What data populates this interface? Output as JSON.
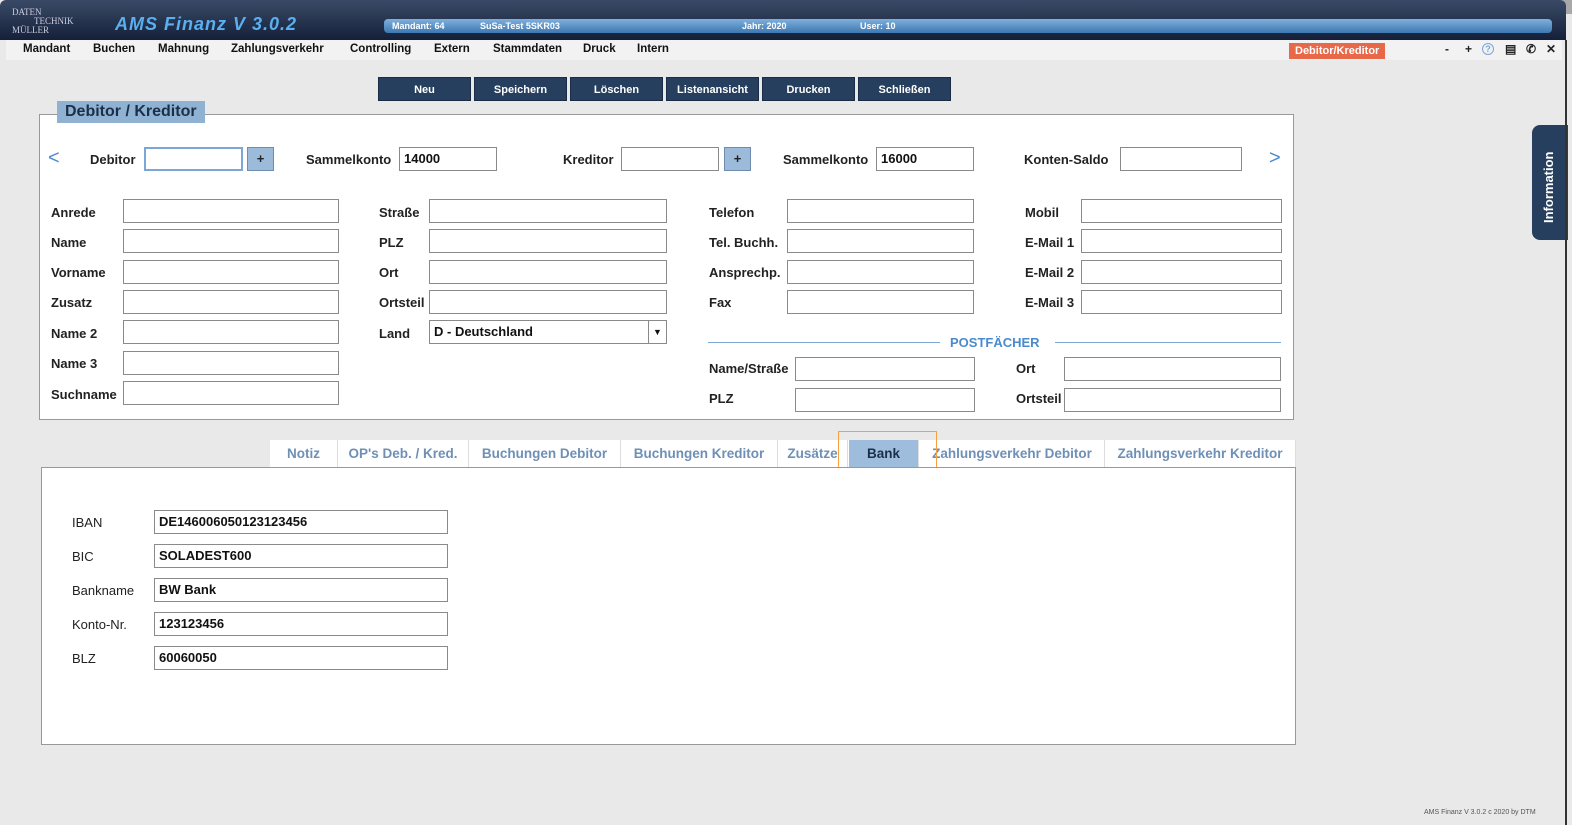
{
  "app": {
    "logo": [
      "DATEN",
      "TECHNIK",
      "MÜLLER"
    ],
    "title": "AMS Finanz V 3.0.2",
    "mandant": "Mandant: 64",
    "mandant_name": "SuSa-Test 5SKR03",
    "jahr": "Jahr: 2020",
    "user": "User: 10",
    "footer": "AMS Finanz V 3.0.2 c  2020 by DTM"
  },
  "menu": [
    "Mandant",
    "Buchen",
    "Mahnung",
    "Zahlungsverkehr",
    "Controlling",
    "Extern",
    "Stammdaten",
    "Druck",
    "Intern"
  ],
  "context_badge": "Debitor/Kreditor",
  "title_icons": {
    "minimize": "-",
    "maximize": "+",
    "help": "?",
    "notes": "▤",
    "phone": "✆",
    "close": "✕"
  },
  "toolbar": [
    "Neu",
    "Speichern",
    "Löschen",
    "Listenansicht",
    "Drucken",
    "Schließen"
  ],
  "form": {
    "title": "Debitor / Kreditor",
    "debitor_label": "Debitor",
    "debitor": "",
    "sammelkonto_label": "Sammelkonto",
    "sammelkonto_deb": "14000",
    "kreditor_label": "Kreditor",
    "kreditor": "",
    "sammelkonto_kred": "16000",
    "saldo_label": "Konten-Saldo",
    "saldo": "",
    "plus": "+",
    "prev": "<",
    "next": ">",
    "col1": [
      "Anrede",
      "Name",
      "Vorname",
      "Zusatz",
      "Name 2",
      "Name 3",
      "Suchname"
    ],
    "col2": [
      "Straße",
      "PLZ",
      "Ort",
      "Ortsteil",
      "Land"
    ],
    "land": "D -  Deutschland",
    "col3": [
      "Telefon",
      "Tel. Buchh.",
      "Ansprechp.",
      "Fax"
    ],
    "col4": [
      "Mobil",
      "E-Mail 1",
      "E-Mail 2",
      "E-Mail 3"
    ],
    "postfaecher": "POSTFÄCHER",
    "pf": [
      "Name/Straße",
      "PLZ",
      "Ort",
      "Ortsteil"
    ]
  },
  "tabs": [
    "Notiz",
    "OP's Deb. / Kred.",
    "Buchungen Debitor",
    "Buchungen Kreditor",
    "Zusätze",
    "Bank",
    "Zahlungsverkehr Debitor",
    "Zahlungsverkehr Kreditor"
  ],
  "active_tab": "Bank",
  "bank": [
    {
      "label": "IBAN",
      "value": "DE146006050123123456"
    },
    {
      "label": "BIC",
      "value": "SOLADEST600"
    },
    {
      "label": "Bankname",
      "value": "BW Bank"
    },
    {
      "label": "Konto-Nr.",
      "value": "123123456"
    },
    {
      "label": "BLZ",
      "value": "60060050"
    }
  ],
  "side_tab": "Information",
  "colors": {
    "accent": "#263f5e",
    "badge": "#e8684a",
    "highlight": "#f7a040"
  }
}
